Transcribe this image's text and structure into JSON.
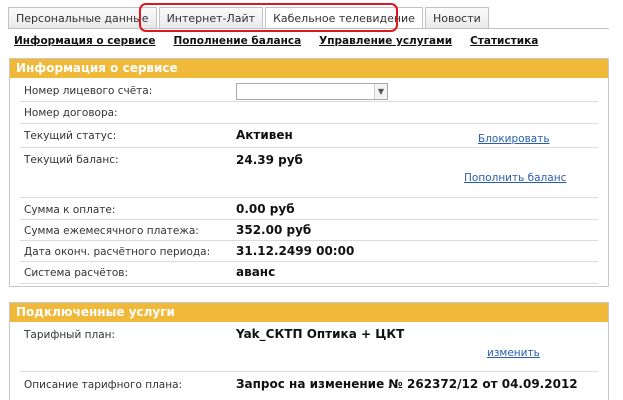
{
  "tabs": [
    {
      "label": "Персональные данные"
    },
    {
      "label": "Интернет-Лайт"
    },
    {
      "label": "Кабельное телевидение"
    },
    {
      "label": "Новости"
    }
  ],
  "subnav": [
    {
      "label": "Информация о сервисе"
    },
    {
      "label": "Пополнение баланса"
    },
    {
      "label": "Управление услугами"
    },
    {
      "label": "Статистика"
    }
  ],
  "service_info": {
    "header": "Информация о сервисе",
    "account_label": "Номер лицевого счёта:",
    "account_value": "",
    "contract_label": "Номер договора:",
    "status_label": "Текущий статус:",
    "status_value": "Активен",
    "block_link": "Блокировать",
    "balance_label": "Текущий баланс:",
    "balance_value": "24.39 руб",
    "topup_link": "Пополнить баланс",
    "due_label": "Сумма к оплате:",
    "due_value": "0.00 руб",
    "monthly_label": "Сумма ежемесячного платежа:",
    "monthly_value": "352.00 руб",
    "period_end_label": "Дата оконч. расчётного периода:",
    "period_end_value": "31.12.2499 00:00",
    "billing_label": "Система расчётов:",
    "billing_value": "аванс"
  },
  "services": {
    "header": "Подключенные услуги",
    "plan_label": "Тарифный план:",
    "plan_value": "Yak_СКТП Оптика + ЦКТ",
    "change_link": "изменить",
    "plan_desc_label": "Описание тарифного плана:",
    "plan_desc_value": "Запрос на изменение № 262372/12 от 04.09.2012"
  },
  "colors": {
    "header_bg": "#f0b93a",
    "highlight": "#e0161d",
    "link": "#2a5db0"
  }
}
